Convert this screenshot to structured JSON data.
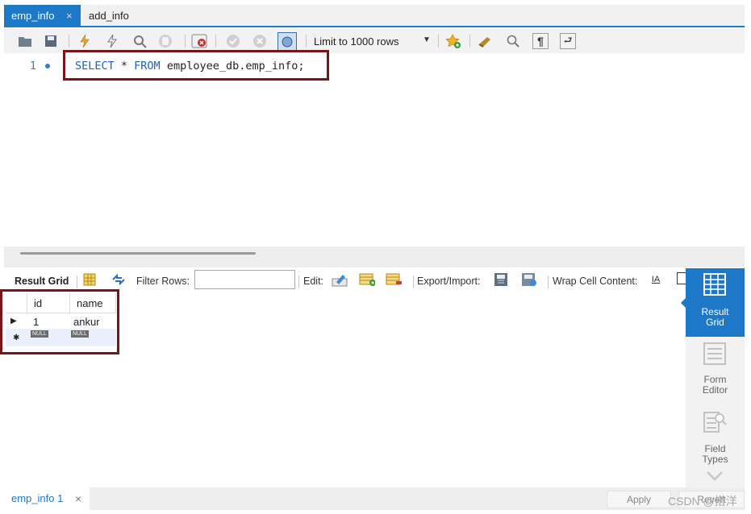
{
  "tabs": {
    "active_label": "emp_info",
    "close_glyph": "×",
    "second_label": "add_info"
  },
  "toolbar": {
    "limit_label": "Limit to 1000 rows",
    "icons": [
      "open-folder-icon",
      "save-icon",
      "execute-icon",
      "execute-current-icon",
      "explain-icon",
      "stop-icon",
      "toggle-error-icon",
      "commit-icon",
      "rollback-icon",
      "autocommit-icon",
      "add-snippet-icon",
      "beautify-icon",
      "find-icon",
      "invisible-chars-icon",
      "wrap-icon"
    ]
  },
  "editor": {
    "line_number": "1",
    "sql_kw1": "SELECT",
    "sql_star": " * ",
    "sql_kw2": "FROM",
    "sql_rest": " employee_db.emp_info;"
  },
  "results": {
    "result_grid_label": "Result Grid",
    "filter_label": "Filter Rows:",
    "filter_value": "",
    "edit_label": "Edit:",
    "export_label": "Export/Import:",
    "wrap_label": "Wrap Cell Content:",
    "columns": [
      "id",
      "name"
    ],
    "rows": [
      [
        "1",
        "ankur"
      ]
    ],
    "null_label": "NULL"
  },
  "side_panel": {
    "items": [
      {
        "line1": "Result",
        "line2": "Grid"
      },
      {
        "line1": "Form",
        "line2": "Editor"
      },
      {
        "line1": "Field",
        "line2": "Types"
      }
    ]
  },
  "bottom": {
    "tab_label": "emp_info 1",
    "close_glyph": "×",
    "apply_label": "Apply",
    "revert_label": "Revert"
  },
  "watermark": "CSDN @搭洋",
  "colors": {
    "accent": "#1e78c8",
    "highlight_border": "#7a1418",
    "keyword": "#2060c0"
  }
}
